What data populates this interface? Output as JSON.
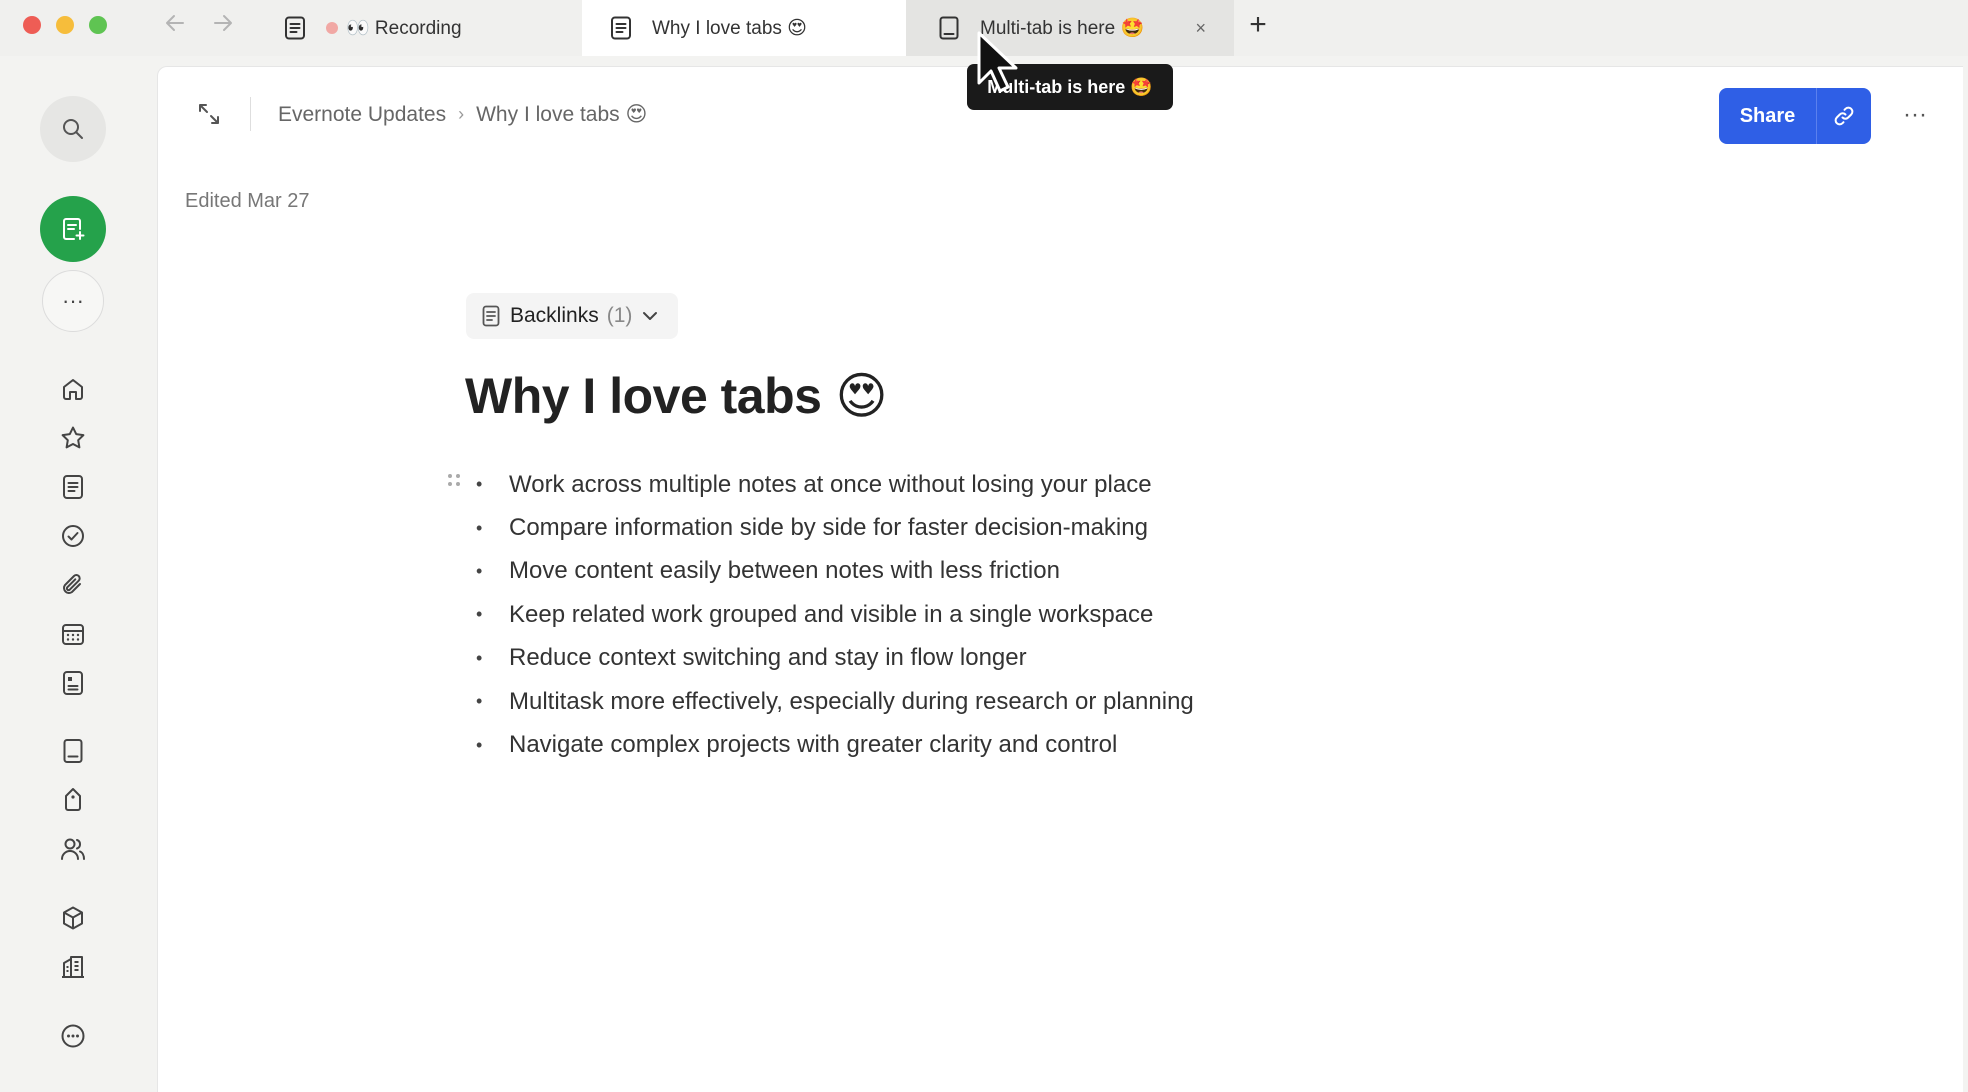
{
  "window": {
    "controls": [
      "close",
      "minimize",
      "maximize"
    ]
  },
  "nav": {
    "back_icon": "arrow-left-icon",
    "forward_icon": "arrow-right-icon"
  },
  "tabs": [
    {
      "label": "👀 Recording",
      "icon": "note-icon",
      "active": false,
      "status": "recording"
    },
    {
      "label": "Why I love tabs 😍",
      "icon": "note-icon",
      "active": true
    },
    {
      "label": "Multi-tab is here 🤩",
      "icon": "notebook-icon",
      "active": false,
      "hovered": true,
      "close_label": "×"
    }
  ],
  "tab_add_label": "+",
  "tooltip": {
    "text": "Multi-tab is here 🤩"
  },
  "sidebar": {
    "search_icon": "search-icon",
    "new_note_icon": "new-note-icon",
    "more_label": "···",
    "items": [
      {
        "name": "home",
        "icon": "home-icon"
      },
      {
        "name": "shortcuts",
        "icon": "star-icon"
      },
      {
        "name": "notes",
        "icon": "note-icon"
      },
      {
        "name": "tasks",
        "icon": "check-circle-icon"
      },
      {
        "name": "files",
        "icon": "paperclip-icon"
      },
      {
        "name": "calendar",
        "icon": "calendar-icon"
      },
      {
        "name": "templates",
        "icon": "template-icon"
      },
      {
        "name": "notebooks",
        "icon": "notebook-icon"
      },
      {
        "name": "tags",
        "icon": "tag-icon"
      },
      {
        "name": "shared",
        "icon": "people-icon"
      },
      {
        "name": "spaces",
        "icon": "cube-icon"
      },
      {
        "name": "business",
        "icon": "building-icon"
      },
      {
        "name": "more",
        "icon": "more-circle-icon"
      }
    ],
    "new_note_color": "#25a24b"
  },
  "breadcrumb": {
    "notebook": "Evernote Updates",
    "separator": "›",
    "note": "Why I love tabs 😍"
  },
  "edited": "Edited Mar 27",
  "share": {
    "label": "Share",
    "color": "#2f5fe6"
  },
  "more_menu_label": "···",
  "backlinks": {
    "label": "Backlinks",
    "count": "(1)"
  },
  "note": {
    "title": "Why I love tabs",
    "title_emoji": "😍",
    "bullets": [
      "Work across multiple notes at once without losing your place",
      "Compare information side by side for faster decision-making",
      "Move content easily between notes with less friction",
      "Keep related work grouped and visible in a single workspace",
      "Reduce context switching and stay in flow longer",
      "Multitask more effectively, especially during research or planning",
      "Navigate complex projects with greater clarity and control"
    ],
    "bullet_char": "•"
  }
}
